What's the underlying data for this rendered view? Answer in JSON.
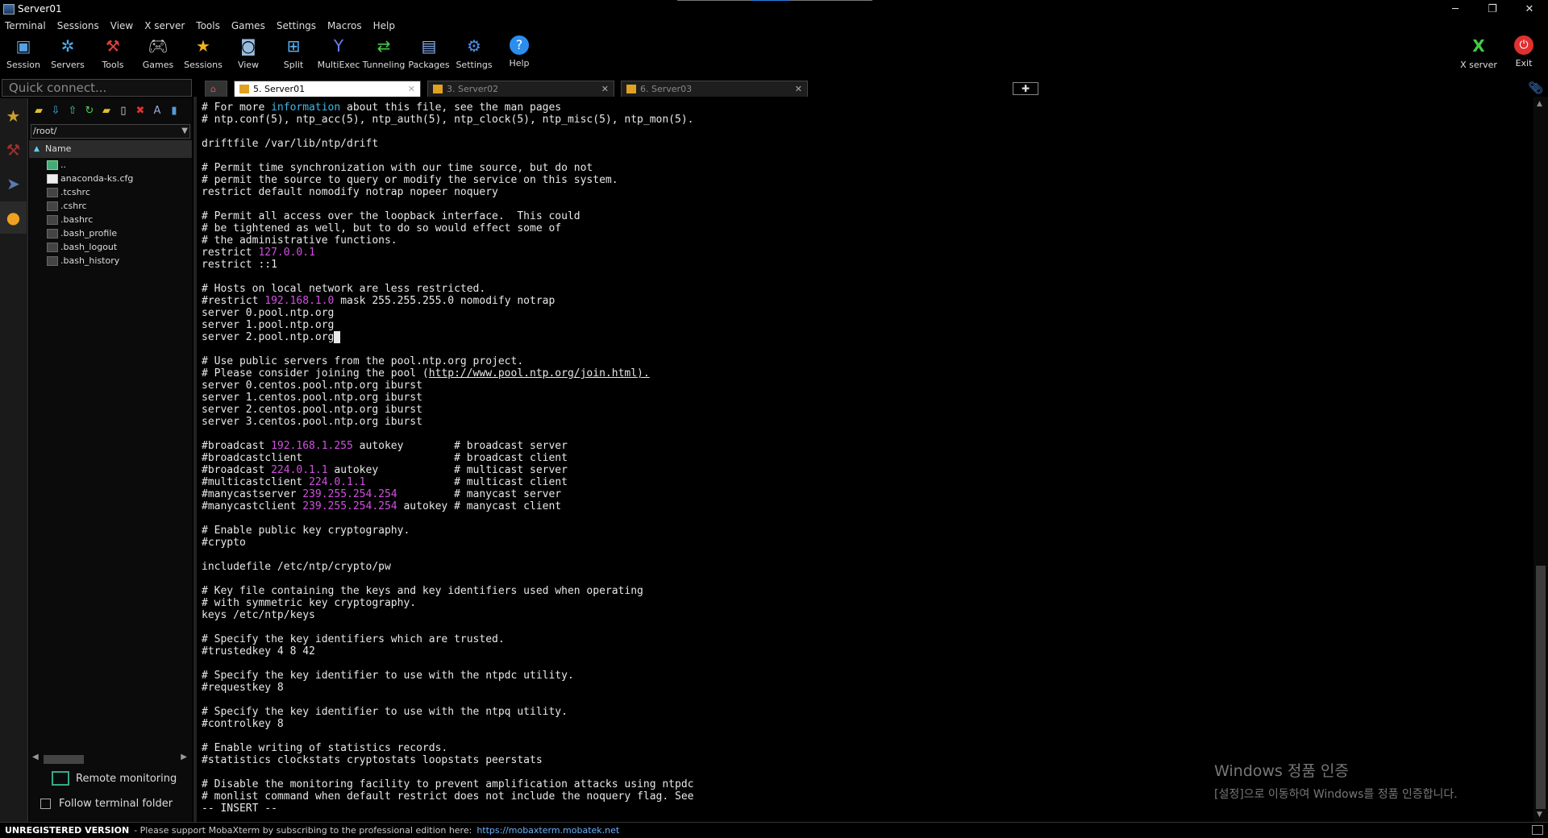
{
  "window": {
    "title": "Server01",
    "controls": [
      "─",
      "❐",
      "✕"
    ]
  },
  "menu": [
    "Terminal",
    "Sessions",
    "View",
    "X server",
    "Tools",
    "Games",
    "Settings",
    "Macros",
    "Help"
  ],
  "toolbar": {
    "items": [
      {
        "label": "Session",
        "icon": "session-icon"
      },
      {
        "label": "Servers",
        "icon": "servers-icon"
      },
      {
        "label": "Tools",
        "icon": "tools-icon"
      },
      {
        "label": "Games",
        "icon": "games-icon"
      },
      {
        "label": "Sessions",
        "icon": "star-icon"
      },
      {
        "label": "View",
        "icon": "view-icon"
      },
      {
        "label": "Split",
        "icon": "split-icon"
      },
      {
        "label": "MultiExec",
        "icon": "multiexec-icon"
      },
      {
        "label": "Tunneling",
        "icon": "tunneling-icon"
      },
      {
        "label": "Packages",
        "icon": "packages-icon"
      },
      {
        "label": "Settings",
        "icon": "gear-icon"
      },
      {
        "label": "Help",
        "icon": "help-icon"
      }
    ],
    "right": [
      {
        "label": "X server",
        "icon": "x-server-icon"
      },
      {
        "label": "Exit",
        "icon": "power-icon"
      }
    ]
  },
  "quick_connect": {
    "placeholder": "Quick connect..."
  },
  "file_panel": {
    "path": "/root/",
    "column": "Name",
    "files": [
      "..",
      "anaconda-ks.cfg",
      ".tcshrc",
      ".cshrc",
      ".bashrc",
      ".bash_profile",
      ".bash_logout",
      ".bash_history"
    ],
    "remote_monitoring": "Remote monitoring",
    "follow_folder": "Follow terminal folder"
  },
  "tabs": [
    {
      "label": "5. Server01",
      "active": true
    },
    {
      "label": "3. Server02",
      "active": false
    },
    {
      "label": "6. Server03",
      "active": false
    }
  ],
  "terminal": {
    "mode": "-- INSERT --",
    "colors": {
      "comment_keyword": "#3fb8e8",
      "ip": "#d050e0"
    }
  },
  "watermark": {
    "line1": "Windows 정품 인증",
    "line2": "[설정]으로 이동하여 Windows를 정품 인증합니다."
  },
  "status": {
    "label": "UNREGISTERED VERSION",
    "message": "-  Please support MobaXterm by subscribing to the professional edition here:",
    "link": "https://mobaxterm.mobatek.net"
  }
}
